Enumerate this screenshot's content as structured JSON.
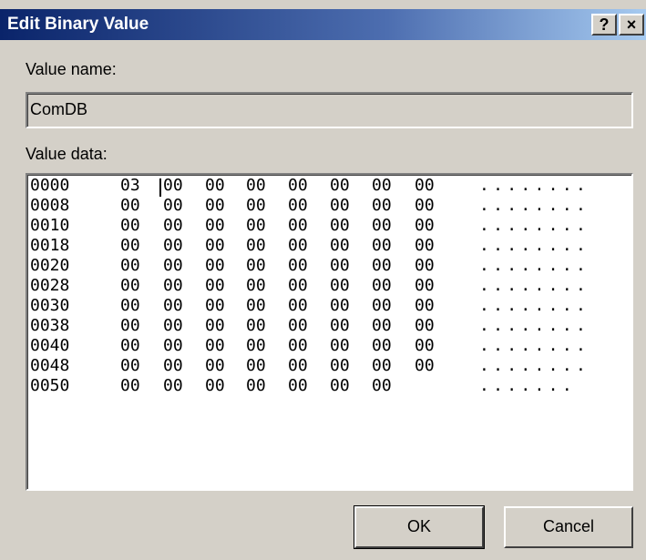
{
  "window": {
    "title": "Edit Binary Value",
    "help_label": "?",
    "close_label": "×"
  },
  "value_name": {
    "label": "Value name:",
    "value": "ComDB"
  },
  "value_data": {
    "label": "Value data:",
    "lines": [
      {
        "offset": "0000",
        "bytes": [
          "03",
          "00",
          "00",
          "00",
          "00",
          "00",
          "00",
          "00"
        ],
        "ascii": "........"
      },
      {
        "offset": "0008",
        "bytes": [
          "00",
          "00",
          "00",
          "00",
          "00",
          "00",
          "00",
          "00"
        ],
        "ascii": "........"
      },
      {
        "offset": "0010",
        "bytes": [
          "00",
          "00",
          "00",
          "00",
          "00",
          "00",
          "00",
          "00"
        ],
        "ascii": "........"
      },
      {
        "offset": "0018",
        "bytes": [
          "00",
          "00",
          "00",
          "00",
          "00",
          "00",
          "00",
          "00"
        ],
        "ascii": "........"
      },
      {
        "offset": "0020",
        "bytes": [
          "00",
          "00",
          "00",
          "00",
          "00",
          "00",
          "00",
          "00"
        ],
        "ascii": "........"
      },
      {
        "offset": "0028",
        "bytes": [
          "00",
          "00",
          "00",
          "00",
          "00",
          "00",
          "00",
          "00"
        ],
        "ascii": "........"
      },
      {
        "offset": "0030",
        "bytes": [
          "00",
          "00",
          "00",
          "00",
          "00",
          "00",
          "00",
          "00"
        ],
        "ascii": "........"
      },
      {
        "offset": "0038",
        "bytes": [
          "00",
          "00",
          "00",
          "00",
          "00",
          "00",
          "00",
          "00"
        ],
        "ascii": "........"
      },
      {
        "offset": "0040",
        "bytes": [
          "00",
          "00",
          "00",
          "00",
          "00",
          "00",
          "00",
          "00"
        ],
        "ascii": "........"
      },
      {
        "offset": "0048",
        "bytes": [
          "00",
          "00",
          "00",
          "00",
          "00",
          "00",
          "00",
          "00"
        ],
        "ascii": "........"
      },
      {
        "offset": "0050",
        "bytes": [
          "00",
          "00",
          "00",
          "00",
          "00",
          "00",
          "00"
        ],
        "ascii": "......."
      }
    ]
  },
  "buttons": {
    "ok": "OK",
    "cancel": "Cancel"
  }
}
